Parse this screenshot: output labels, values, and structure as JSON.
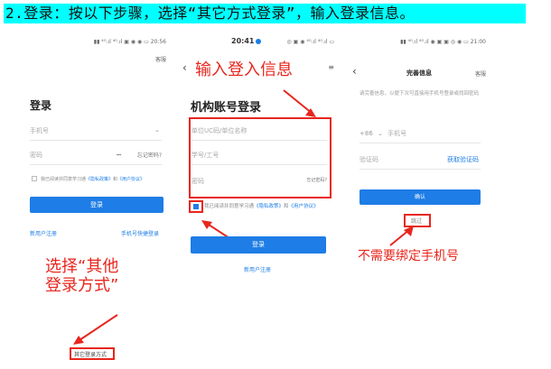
{
  "banner": {
    "text": "2.登录：按以下步骤，选择“其它方式登录”，输入登录信息。"
  },
  "screen1": {
    "status": "20:56",
    "help": "客服",
    "title": "登录",
    "phone_placeholder": "手机号",
    "password_placeholder": "密码",
    "forgot_password": "忘记密码?",
    "agree_prefix": "我已阅读并同意学习通",
    "privacy_policy": "《隐私政策》",
    "and": "和",
    "user_agreement": "《用户协议》",
    "login_button": "登录",
    "register": "新用户注册",
    "phone_quick_login": "手机号快捷登录",
    "other_login": "其它登录方式",
    "annotation": "选择“其他\n登录方式”"
  },
  "screen2": {
    "status": "20:41",
    "title": "机构账号登录",
    "org_placeholder": "单位UC码/单位名称",
    "id_placeholder": "学号/工号",
    "password_placeholder": "密码",
    "forgot_password": "忘记密码?",
    "agree_prefix": "我已阅读并同意学习通",
    "privacy_policy": "《隐私政策》",
    "and": "和",
    "user_agreement": "《用户协议》",
    "login_button": "登录",
    "register": "新用户注册",
    "annotation": "输入登入信息"
  },
  "screen3": {
    "status": "21:00",
    "help": "客服",
    "title": "完善信息",
    "desc": "请完善信息，以便下次可直接用手机号登录或找回密码",
    "country_code": "+86",
    "phone_placeholder": "手机号",
    "code_placeholder": "验证码",
    "get_code": "获取验证码",
    "confirm_button": "确认",
    "skip": "跳过",
    "annotation": "不需要绑定手机号"
  },
  "colors": {
    "accent": "#1e7de6",
    "annotation": "#e8261e",
    "banner": "#00ffff"
  }
}
